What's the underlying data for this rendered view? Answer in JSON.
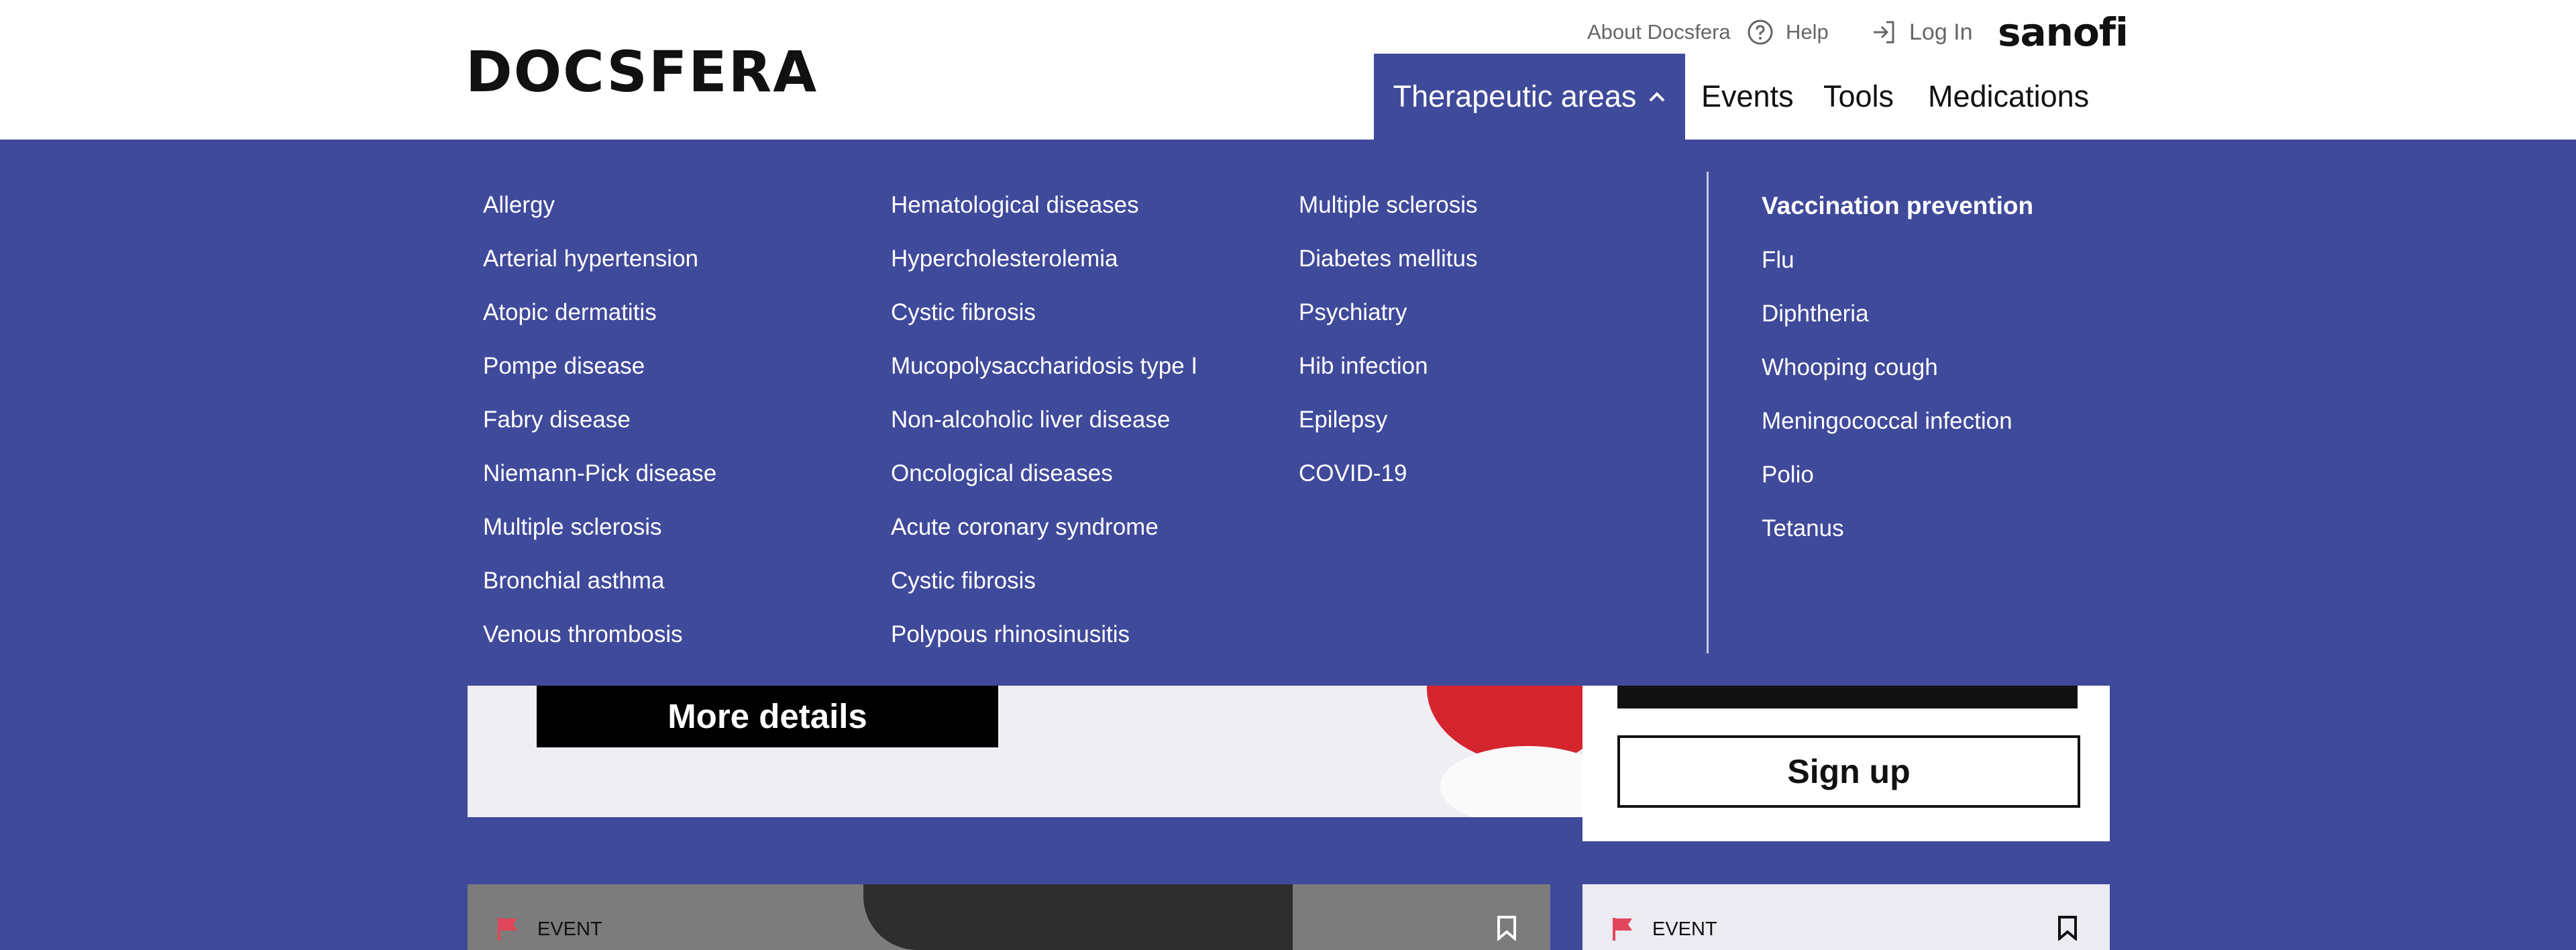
{
  "header": {
    "logo": "DOCSFERA",
    "about": "About Docsfera",
    "help": "Help",
    "login": "Log In",
    "brand": "sanofi",
    "nav": {
      "therapeutic_areas": "Therapeutic areas",
      "events": "Events",
      "tools": "Tools",
      "medications": "Medications"
    }
  },
  "menu": {
    "col1": [
      "Allergy",
      "Arterial hypertension",
      "Atopic dermatitis",
      "Pompe disease",
      "Fabry disease",
      "Niemann-Pick disease",
      "Multiple sclerosis",
      "Bronchial asthma",
      "Venous thrombosis"
    ],
    "col2": [
      "Hematological diseases",
      "Hypercholesterolemia",
      "Cystic fibrosis",
      "Mucopolysaccharidosis type I",
      "Non-alcoholic liver disease",
      "Oncological diseases",
      "Acute coronary syndrome",
      "Cystic fibrosis",
      "Polypous rhinosinusitis"
    ],
    "col3": [
      "Multiple sclerosis",
      "Diabetes mellitus",
      "Psychiatry",
      "Hib infection",
      "Epilepsy",
      "COVID-19"
    ],
    "vaccination": {
      "title": "Vaccination prevention",
      "items": [
        "Flu",
        "Diphtheria",
        "Whooping cough",
        "Meningococcal infection",
        "Polio",
        "Tetanus"
      ]
    }
  },
  "page": {
    "more_details": "More details",
    "sign_up": "Sign up",
    "event_tag_1": "EVENT",
    "event_tag_2": "EVENT"
  },
  "colors": {
    "primary": "#3f4a9b",
    "event_flag": "#e0475a"
  }
}
